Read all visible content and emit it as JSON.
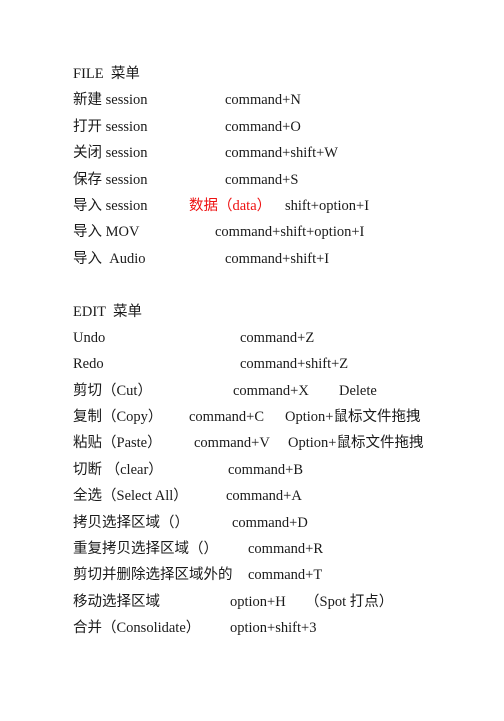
{
  "document": {
    "title": "Keyboard Shortcuts Reference",
    "language": "zh-CN",
    "accent_red": "#ee1111",
    "text_color": "#1a1a1a",
    "background": "#ffffff"
  },
  "sections": [
    {
      "id": "file-menu",
      "heading": "FILE  菜单",
      "rows": [
        {
          "label": "新建 session",
          "shortcut": "command+N"
        },
        {
          "label": "打开 session",
          "shortcut": "command+O"
        },
        {
          "label": "关闭 session",
          "shortcut": "command+shift+W"
        },
        {
          "label": "保存 session",
          "shortcut": "command+S"
        },
        {
          "label": "导入 session ",
          "label_red": "数据（data）",
          "shortcut": "shift+option+I"
        },
        {
          "label": "导入 MOV",
          "shortcut": "command+shift+option+I"
        },
        {
          "label": "导入  Audio",
          "shortcut": "command+shift+I"
        }
      ]
    },
    {
      "id": "edit-menu",
      "heading": "EDIT  菜单",
      "rows": [
        {
          "label": "Undo",
          "shortcut": "command+Z"
        },
        {
          "label": "Redo",
          "shortcut": "command+shift+Z"
        },
        {
          "label": "剪切（Cut）",
          "shortcut": "command+X",
          "extra": "Delete"
        },
        {
          "label": "复制（Copy）",
          "shortcut": "command+C",
          "extra": "Option+鼠标文件拖拽"
        },
        {
          "label": "粘贴（Paste）",
          "shortcut": "command+V",
          "extra": "Option+鼠标文件拖拽"
        },
        {
          "label": "切断 （clear）",
          "shortcut": "command+B"
        },
        {
          "label": "全选（Select All）",
          "shortcut": "command+A"
        },
        {
          "label": "拷贝选择区域（）",
          "shortcut": "command+D"
        },
        {
          "label": "重复拷贝选择区域（）",
          "shortcut": "command+R"
        },
        {
          "label": "剪切并删除选择区域外的",
          "shortcut": "command+T"
        },
        {
          "label": "移动选择区域",
          "shortcut": "option+H",
          "extra": "（Spot 打点）"
        },
        {
          "label": "合并（Consolidate）",
          "shortcut": "option+shift+3"
        }
      ]
    }
  ]
}
